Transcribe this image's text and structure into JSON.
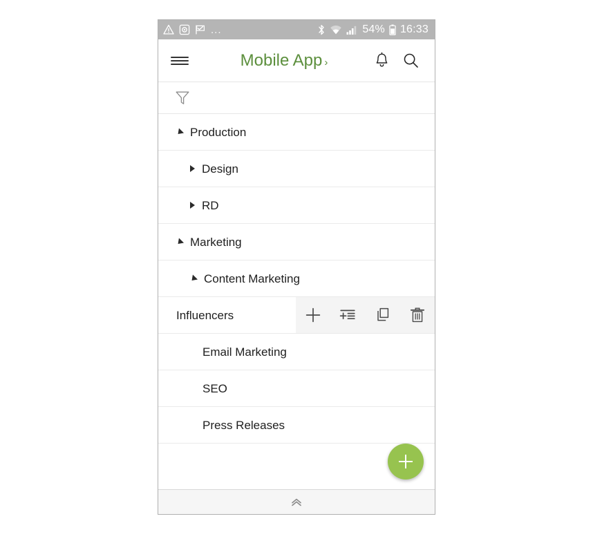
{
  "status_bar": {
    "left_icons": [
      "warning-triangle-icon",
      "camera-icon",
      "flag-check-icon"
    ],
    "overflow": "...",
    "right_icons": [
      "bluetooth-icon",
      "wifi-icon",
      "signal-icon"
    ],
    "battery_percent": "54%",
    "battery_icon": "battery-icon",
    "clock": "16:33",
    "background_color": "#b5b5b5"
  },
  "app_bar": {
    "menu_icon": "hamburger-menu-icon",
    "title": "Mobile App",
    "title_chevron": "›",
    "title_color": "#5c8f3d",
    "notifications_icon": "bell-icon",
    "search_icon": "search-icon"
  },
  "filter_bar": {
    "filter_icon": "funnel-filter-icon"
  },
  "tree": {
    "items": [
      {
        "label": "Production",
        "level": 0,
        "state": "expanded"
      },
      {
        "label": "Design",
        "level": 1,
        "state": "collapsed"
      },
      {
        "label": "RD",
        "level": 1,
        "state": "collapsed"
      },
      {
        "label": "Marketing",
        "level": 0,
        "state": "expanded"
      },
      {
        "label": "Content Marketing",
        "level": 1,
        "state": "expanded"
      },
      {
        "label": "Influencers",
        "level": 2,
        "state": "leaf",
        "swiped": true
      },
      {
        "label": "Email Marketing",
        "level": 2,
        "state": "leaf"
      },
      {
        "label": "SEO",
        "level": 2,
        "state": "leaf"
      },
      {
        "label": "Press Releases",
        "level": 2,
        "state": "leaf"
      }
    ]
  },
  "swipe_actions": [
    {
      "name": "add-action",
      "icon": "plus-icon"
    },
    {
      "name": "add-to-list-action",
      "icon": "add-to-list-icon"
    },
    {
      "name": "duplicate-action",
      "icon": "copy-icon"
    },
    {
      "name": "delete-action",
      "icon": "trash-icon"
    }
  ],
  "fab": {
    "icon": "plus-icon",
    "color": "#97c34f"
  },
  "bottom_bar": {
    "icon": "chevron-double-up-icon"
  }
}
